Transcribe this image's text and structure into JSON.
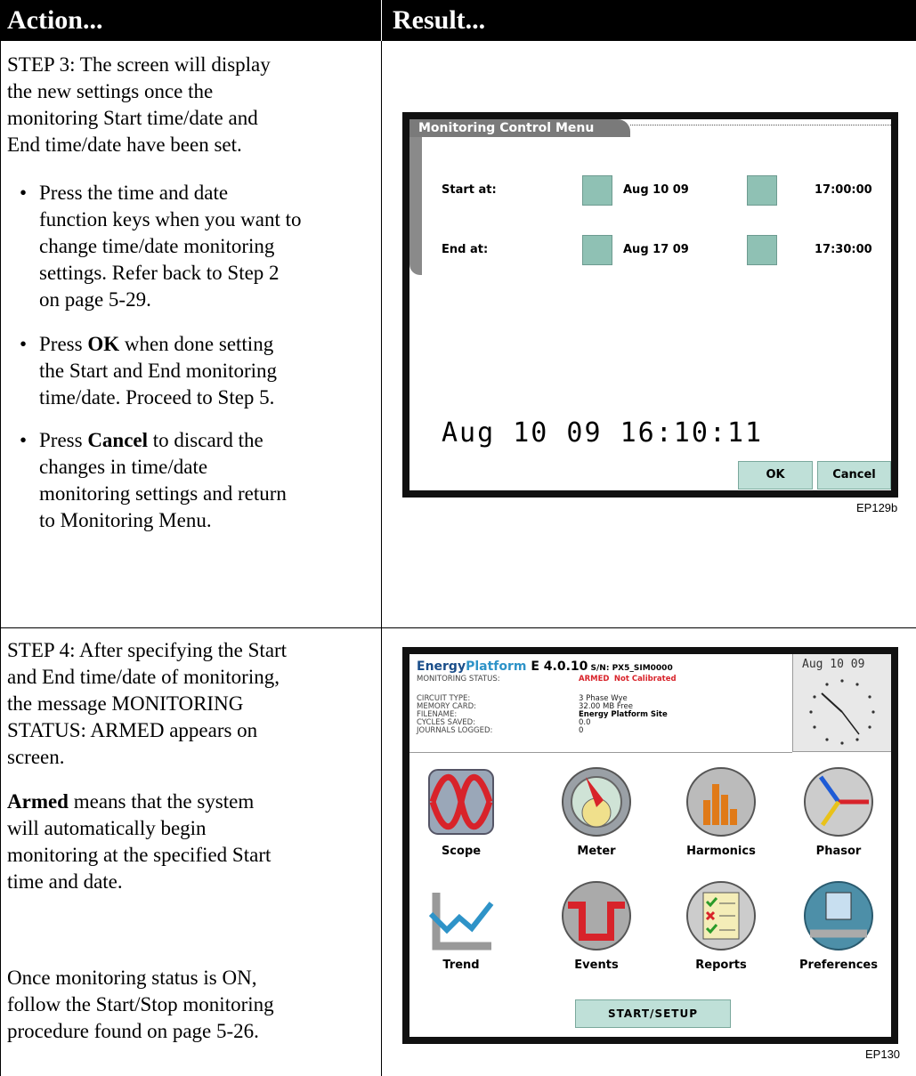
{
  "header": {
    "action": "Action...",
    "result": "Result..."
  },
  "step3": {
    "intro_lines": [
      "STEP 3: The screen will display",
      "the new settings once the",
      "monitoring Start time/date and",
      "End time/date have been set."
    ],
    "bullet1_lines": [
      "Press the time and date",
      "function keys when you want to",
      "change time/date monitoring",
      "settings. Refer back to Step 2",
      "on page 5-29."
    ],
    "bullet2": {
      "pre": "Press ",
      "bold": "OK",
      "post": " when done setting",
      "lines": [
        "the Start and End monitoring",
        "time/date. Proceed to Step 5."
      ]
    },
    "bullet3": {
      "pre": "Press ",
      "bold": "Cancel",
      "post": " to discard the",
      "lines": [
        "changes in time/date",
        "monitoring settings and return",
        "to Monitoring Menu."
      ]
    },
    "bullet_char": "•"
  },
  "screen1": {
    "tab_title": "Monitoring Control Menu",
    "start_label": "Start at:",
    "start_date": "Aug 10 09",
    "start_time": "17:00:00",
    "end_label": "End at:",
    "end_date": "Aug 17 09",
    "end_time": "17:30:00",
    "current_datetime": "Aug 10 09 16:10:11",
    "ok_label": "OK",
    "cancel_label": "Cancel",
    "caption": "EP129b"
  },
  "step4": {
    "lines": [
      "STEP 4: After specifying the Start",
      "and End time/date of monitoring,",
      "the message MONITORING",
      "STATUS: ARMED appears on",
      "screen."
    ],
    "armed_bold": "Armed",
    "armed_rest_first": " means that the system",
    "armed_lines": [
      "will automatically begin",
      "monitoring at the specified Start",
      "time and date."
    ],
    "on_lines": [
      "Once monitoring status is ON,",
      "follow the Start/Stop monitoring",
      "procedure found on page 5-26."
    ]
  },
  "screen2": {
    "title_a": "Energy",
    "title_b": "Platform",
    "title_c": " E 4.0.10",
    "serial": " S/N: PX5_SIM0000",
    "monitoring_status_label": "MONITORING STATUS:",
    "monitoring_status_armed": "ARMED",
    "monitoring_status_cal": "Not Calibrated",
    "labels": [
      "CIRCUIT TYPE:",
      "MEMORY CARD:",
      "FILENAME:",
      "CYCLES SAVED:",
      "JOURNALS LOGGED:"
    ],
    "values": [
      "3 Phase Wye",
      "32.00 MB Free",
      "Energy Platform Site",
      "0.0",
      "0"
    ],
    "clock_date": "Aug 10 09",
    "icons": [
      "Scope",
      "Meter",
      "Harmonics",
      "Phasor",
      "Trend",
      "Events",
      "Reports",
      "Preferences"
    ],
    "start_button": "START/SETUP",
    "caption": "EP130",
    "colors": {
      "accent_teal": "#8fc1b4",
      "status_red": "#d8232a",
      "brand_blue": "#2e93c8"
    }
  }
}
